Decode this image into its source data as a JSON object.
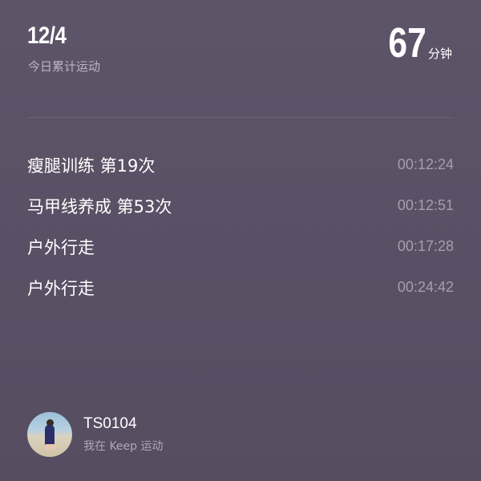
{
  "header": {
    "date": "12/4",
    "label": "今日累计运动",
    "total_minutes": "67",
    "total_unit": "分钟"
  },
  "workouts": [
    {
      "name": "瘦腿训练 第19次",
      "duration": "00:12:24"
    },
    {
      "name": "马甲线养成 第53次",
      "duration": "00:12:51"
    },
    {
      "name": "户外行走",
      "duration": "00:17:28"
    },
    {
      "name": "户外行走",
      "duration": "00:24:42"
    }
  ],
  "user": {
    "name": "TS0104",
    "tagline": "我在 Keep 运动"
  },
  "colors": {
    "background": "#5b5166",
    "secondary_text": "#a69eae"
  }
}
